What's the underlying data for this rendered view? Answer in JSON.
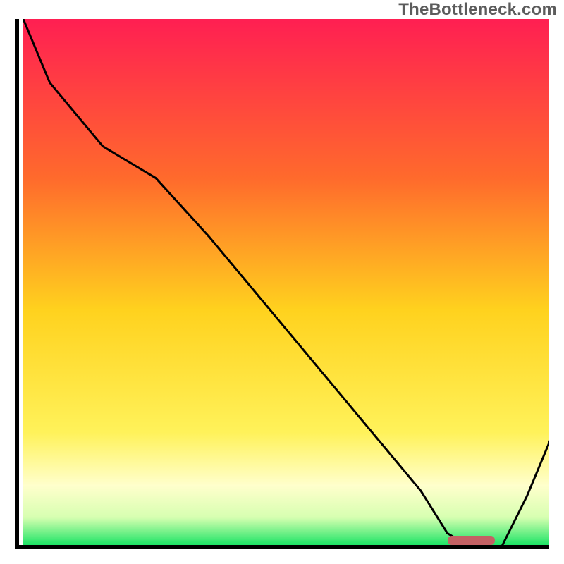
{
  "watermark": "TheBottleneck.com",
  "colors": {
    "axis": "#000000",
    "curve": "#000000",
    "marker": "#c46164",
    "gradient_stops": [
      {
        "offset": 0.0,
        "color": "#ff1f52"
      },
      {
        "offset": 0.3,
        "color": "#ff6a2c"
      },
      {
        "offset": 0.55,
        "color": "#ffd21e"
      },
      {
        "offset": 0.78,
        "color": "#fff25a"
      },
      {
        "offset": 0.88,
        "color": "#ffffcc"
      },
      {
        "offset": 0.94,
        "color": "#d7ffb1"
      },
      {
        "offset": 1.0,
        "color": "#00e05a"
      }
    ]
  },
  "chart_data": {
    "type": "line",
    "title": "",
    "xlabel": "",
    "ylabel": "",
    "xlim": [
      0,
      100
    ],
    "ylim": [
      0,
      100
    ],
    "x": [
      0,
      5,
      15,
      25,
      35,
      45,
      55,
      65,
      75,
      80,
      85,
      90,
      95,
      100
    ],
    "values": [
      100,
      88,
      76,
      70,
      59,
      47,
      35,
      23,
      11,
      3,
      0,
      0,
      10,
      22
    ],
    "marker": {
      "x_start": 80,
      "x_end": 89,
      "y": 1
    }
  }
}
